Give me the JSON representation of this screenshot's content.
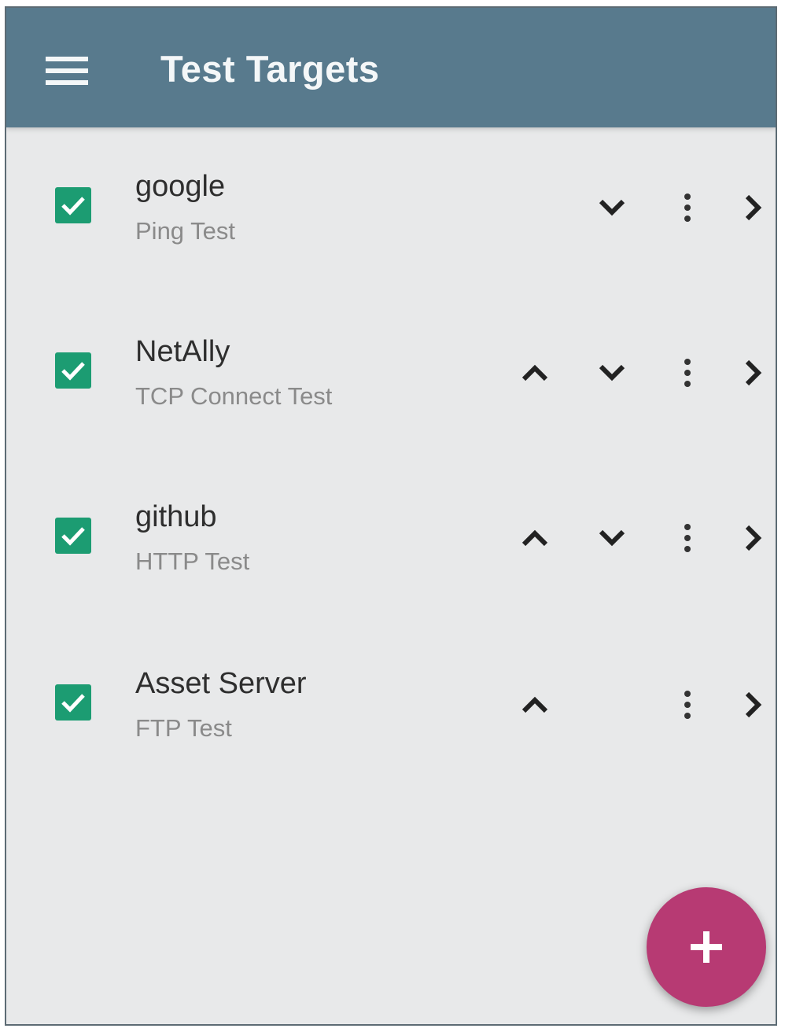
{
  "app_bar": {
    "title": "Test Targets",
    "menu_icon": "hamburger-menu-icon",
    "color": "#587a8d"
  },
  "targets": [
    {
      "name": "google",
      "test_type": "Ping Test",
      "checked": true,
      "can_move_up": false,
      "can_move_down": true
    },
    {
      "name": "NetAlly",
      "test_type": "TCP Connect Test",
      "checked": true,
      "can_move_up": true,
      "can_move_down": true
    },
    {
      "name": "github",
      "test_type": "HTTP Test",
      "checked": true,
      "can_move_up": true,
      "can_move_down": true
    },
    {
      "name": "Asset Server",
      "test_type": "FTP Test",
      "checked": true,
      "can_move_up": true,
      "can_move_down": false
    }
  ],
  "icons": {
    "checkbox": "checkbox-checked-icon",
    "move_up": "chevron-up-icon",
    "move_down": "chevron-down-icon",
    "more": "more-vert-icon",
    "open": "chevron-right-icon",
    "add": "plus-icon"
  },
  "colors": {
    "checkbox": "#1c9c72",
    "fab": "#b73a73",
    "background": "#e8e9ea"
  }
}
